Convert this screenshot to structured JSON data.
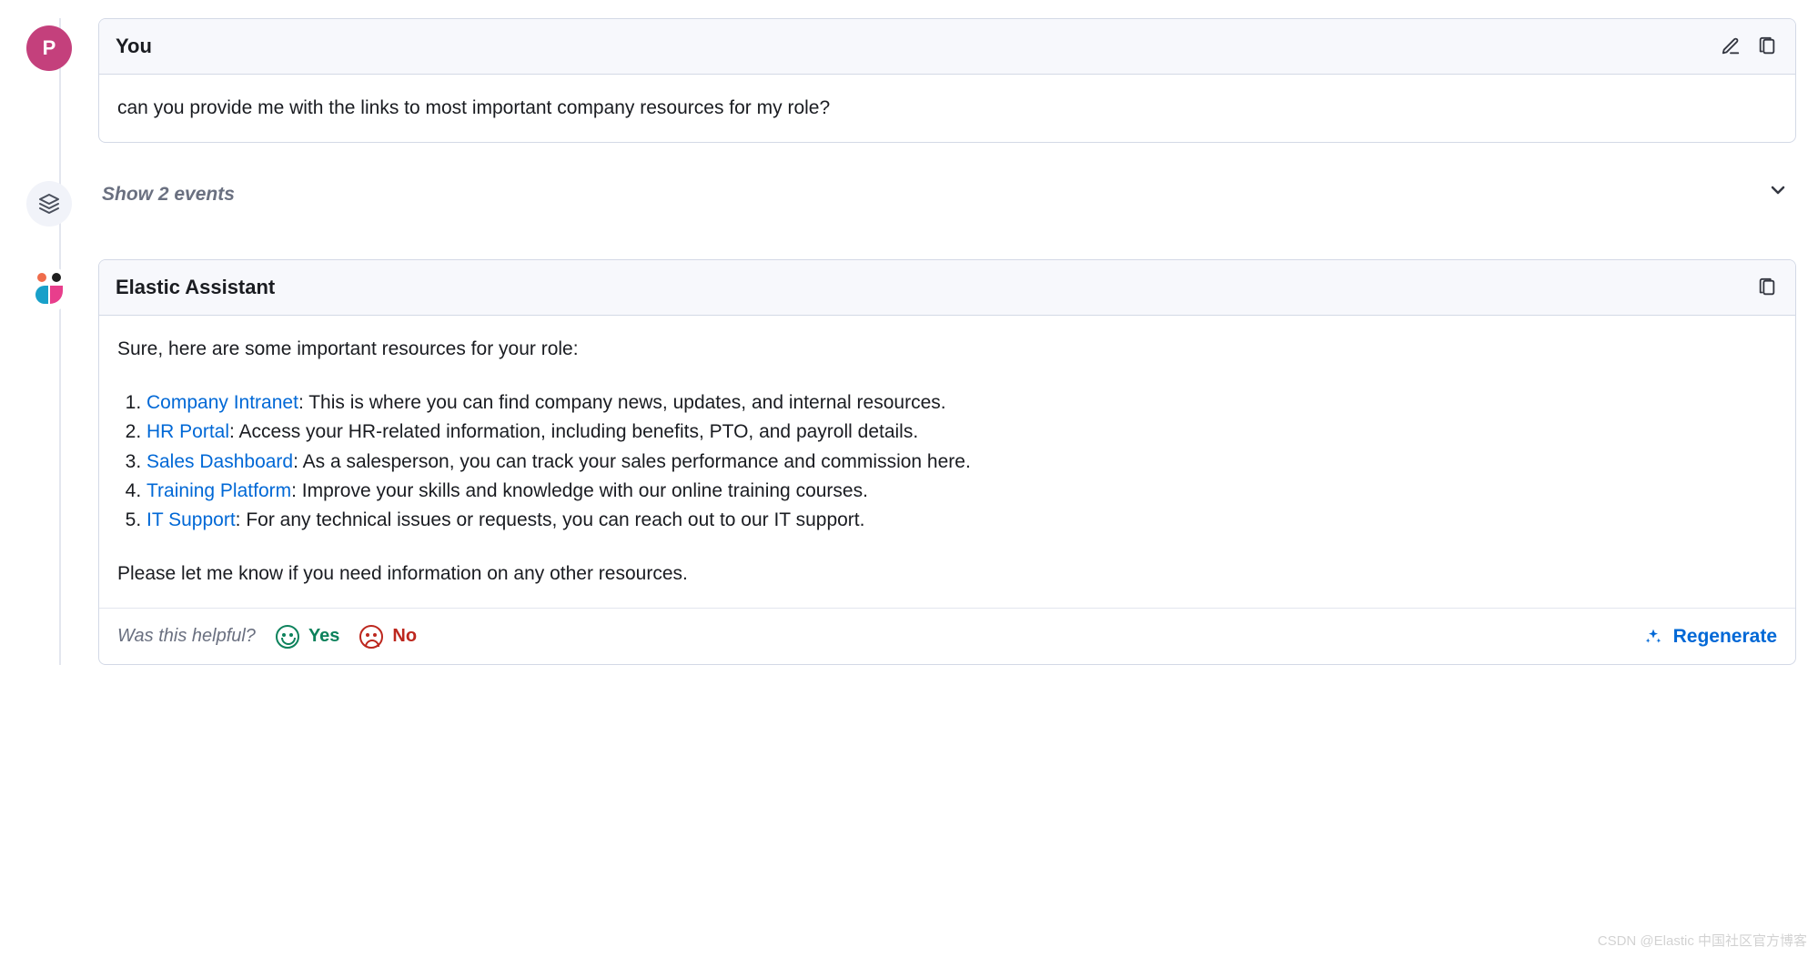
{
  "user": {
    "avatar_letter": "P",
    "header": "You",
    "message": "can you provide me with the links to most important company resources for my role?"
  },
  "events": {
    "label": "Show 2 events"
  },
  "assistant": {
    "header": "Elastic Assistant",
    "intro": "Sure, here are some important resources for your role:",
    "resources": [
      {
        "title": "Company Intranet",
        "desc": ": This is where you can find company news, updates, and internal resources."
      },
      {
        "title": "HR Portal",
        "desc": ": Access your HR-related information, including benefits, PTO, and payroll details."
      },
      {
        "title": "Sales Dashboard",
        "desc": ": As a salesperson, you can track your sales performance and commission here."
      },
      {
        "title": "Training Platform",
        "desc": ": Improve your skills and knowledge with our online training courses."
      },
      {
        "title": "IT Support",
        "desc": ": For any technical issues or requests, you can reach out to our IT support."
      }
    ],
    "outro": "Please let me know if you need information on any other resources."
  },
  "feedback": {
    "prompt": "Was this helpful?",
    "yes": "Yes",
    "no": "No",
    "regenerate": "Regenerate"
  },
  "watermark": "CSDN @Elastic 中国社区官方博客"
}
